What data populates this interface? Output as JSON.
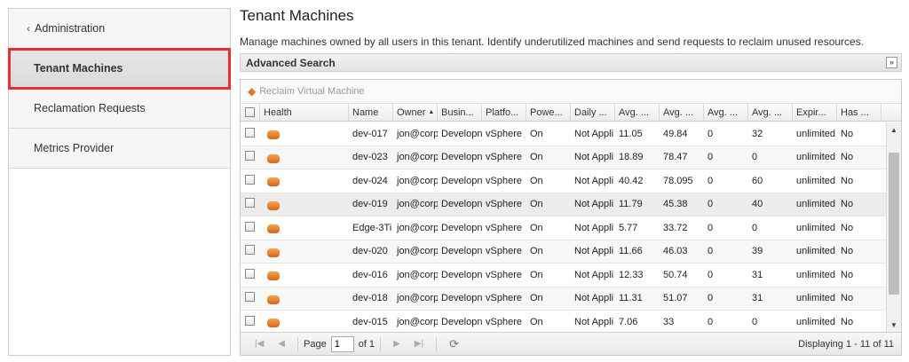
{
  "nav": {
    "back_label": "Administration",
    "items": [
      {
        "label": "Tenant Machines",
        "active": true
      },
      {
        "label": "Reclamation Requests",
        "active": false
      },
      {
        "label": "Metrics Provider",
        "active": false
      }
    ]
  },
  "page": {
    "title": "Tenant Machines",
    "description": "Manage machines owned by all users in this tenant. Identify underutilized machines and send requests to reclaim unused resources."
  },
  "advanced_search": {
    "label": "Advanced Search"
  },
  "toolbar": {
    "reclaim_label": "Reclaim Virtual Machine"
  },
  "table": {
    "columns": [
      "Health",
      "Name",
      "Owner",
      "Busin...",
      "Platfo...",
      "Powe...",
      "Daily ...",
      "Avg. ...",
      "Avg. ...",
      "Avg. ...",
      "Avg. ...",
      "Expir...",
      "Has ..."
    ],
    "sort_indicator": "▲",
    "rows": [
      [
        "",
        "dev-017",
        "jon@corp",
        "Developn",
        "vSphere",
        "On",
        "Not Appli",
        "11.05",
        "49.84",
        "0",
        "32",
        "unlimited",
        "No"
      ],
      [
        "",
        "dev-023",
        "jon@corp",
        "Developn",
        "vSphere",
        "On",
        "Not Appli",
        "18.89",
        "78.47",
        "0",
        "0",
        "unlimited",
        "No"
      ],
      [
        "",
        "dev-024",
        "jon@corp",
        "Developn",
        "vSphere",
        "On",
        "Not Appli",
        "40.42",
        "78.095",
        "0",
        "60",
        "unlimited",
        "No"
      ],
      [
        "",
        "dev-019",
        "jon@corp",
        "Developn",
        "vSphere",
        "On",
        "Not Appli",
        "11.79",
        "45.38",
        "0",
        "40",
        "unlimited",
        "No"
      ],
      [
        "",
        "Edge-3Ti",
        "jon@corp",
        "Developn",
        "vSphere",
        "On",
        "Not Appli",
        "5.77",
        "33.72",
        "0",
        "0",
        "unlimited",
        "No"
      ],
      [
        "",
        "dev-020",
        "jon@corp",
        "Developn",
        "vSphere",
        "On",
        "Not Appli",
        "11.66",
        "46.03",
        "0",
        "39",
        "unlimited",
        "No"
      ],
      [
        "",
        "dev-016",
        "jon@corp",
        "Developn",
        "vSphere",
        "On",
        "Not Appli",
        "12.33",
        "50.74",
        "0",
        "31",
        "unlimited",
        "No"
      ],
      [
        "",
        "dev-018",
        "jon@corp",
        "Developn",
        "vSphere",
        "On",
        "Not Appli",
        "11.31",
        "51.07",
        "0",
        "31",
        "unlimited",
        "No"
      ],
      [
        "",
        "dev-015",
        "jon@corp",
        "Developn",
        "vSphere",
        "On",
        "Not Appli",
        "7.06",
        "33",
        "0",
        "0",
        "unlimited",
        "No"
      ]
    ]
  },
  "pager": {
    "page_label": "Page",
    "page_value": "1",
    "of_label": "of 1",
    "display_text": "Displaying 1 - 11 of 11"
  },
  "colors": {
    "highlight_border": "#e8302e",
    "vm_icon": "#e27a2b"
  }
}
